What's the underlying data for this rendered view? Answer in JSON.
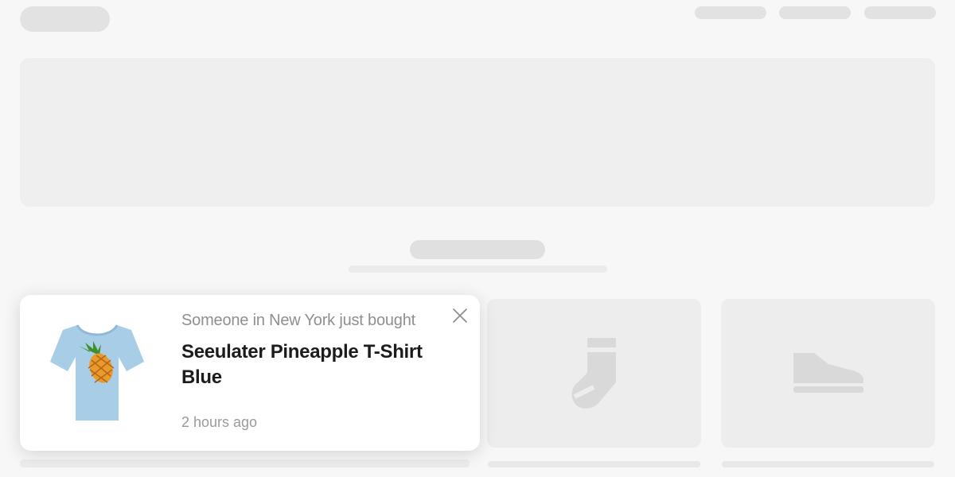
{
  "notification": {
    "location_text": "Someone in New York just bought",
    "product_name": "Seeulater Pineapple T-Shirt Blue",
    "time_ago": "2 hours ago",
    "product_color": "#a8cde6",
    "close_icon": "close-icon"
  },
  "placeholders": {
    "card_icons": [
      "sock-icon",
      "shoe-icon"
    ]
  },
  "colors": {
    "background": "#f7f7f7",
    "skeleton": "#e2e2e2",
    "card": "#ffffff"
  }
}
